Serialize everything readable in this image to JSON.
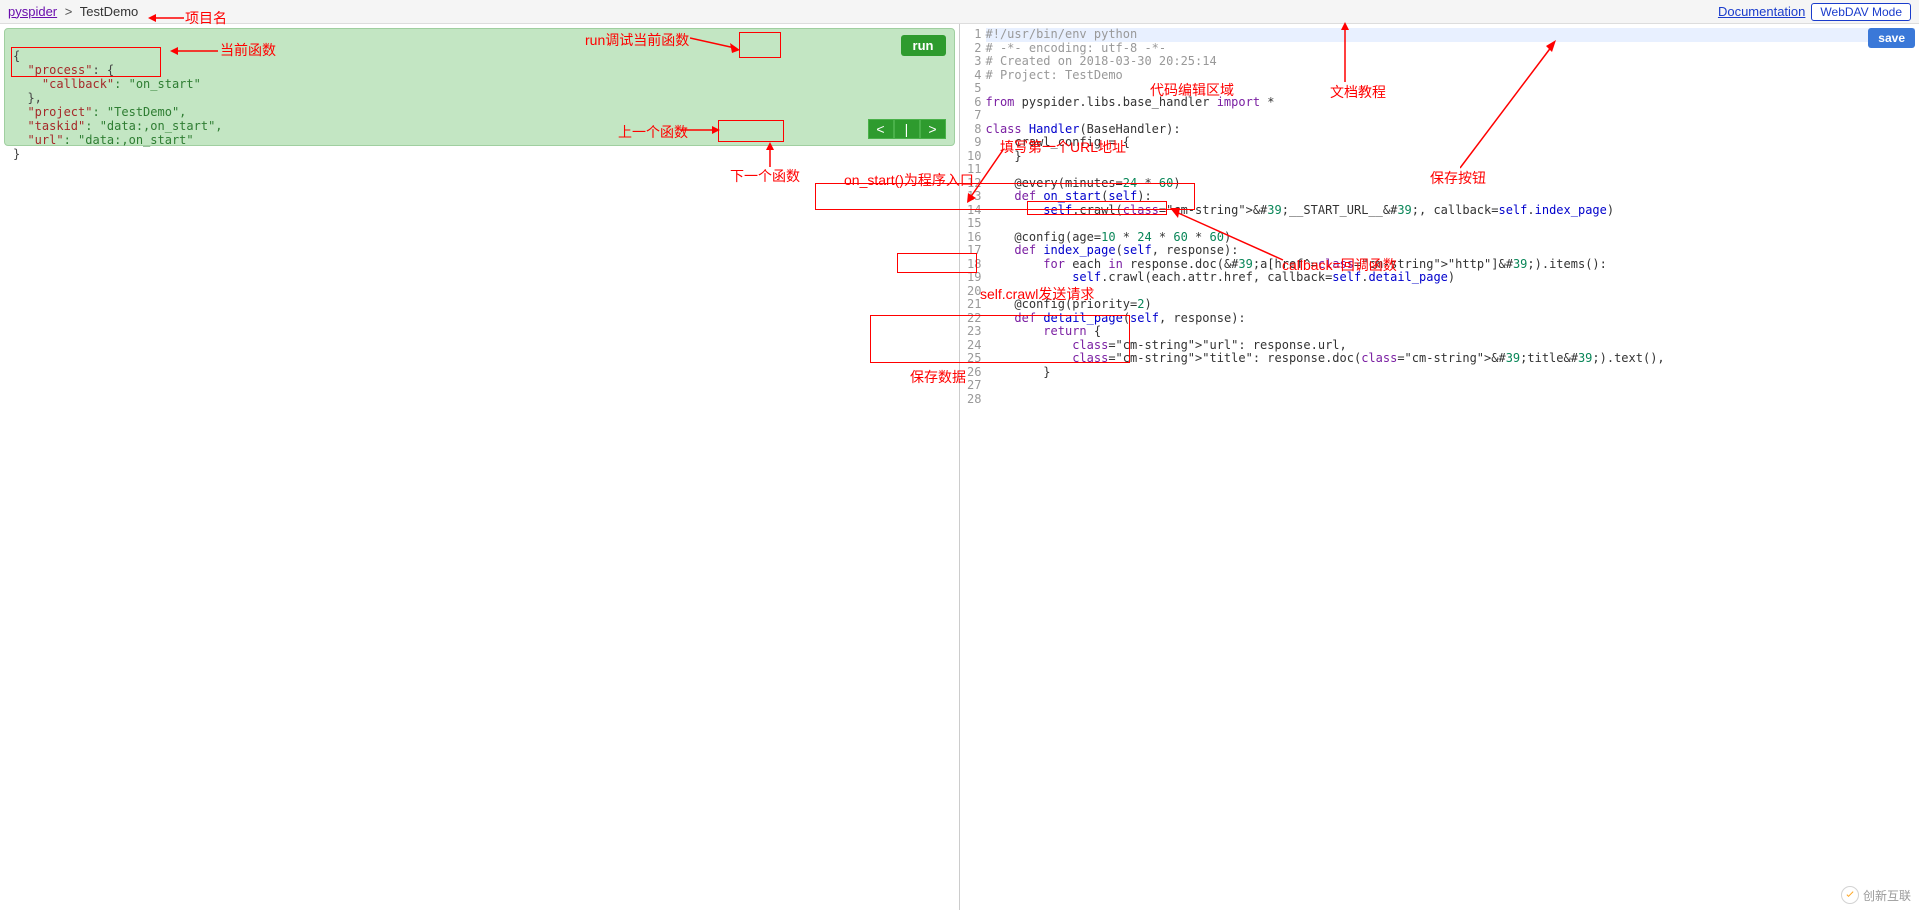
{
  "header": {
    "root_link": "pyspider",
    "sep": ">",
    "project_name": "TestDemo",
    "documentation": "Documentation",
    "webdav": "WebDAV Mode"
  },
  "task_json": {
    "brace_open": "{",
    "l1_key": "\"process\"",
    "l1_open": ": {",
    "l2_key": "\"callback\"",
    "l2_val": ": \"on_start\"",
    "l1_close": "},",
    "l3_key": "\"project\"",
    "l3_val": ": \"TestDemo\",",
    "l4_key": "\"taskid\"",
    "l4_val": ": \"data:,on_start\",",
    "l5_key": "\"url\"",
    "l5_val": ": \"data:,on_start\"",
    "brace_close": "}"
  },
  "buttons": {
    "run": "run",
    "prev": "<",
    "pipe": "|",
    "next": ">",
    "save": "save"
  },
  "code": {
    "line_count": 28,
    "lines": [
      "#!/usr/bin/env python",
      "# -*- encoding: utf-8 -*-",
      "# Created on 2018-03-30 20:25:14",
      "# Project: TestDemo",
      "",
      "from pyspider.libs.base_handler import *",
      "",
      "class Handler(BaseHandler):",
      "    crawl_config = {",
      "    }",
      "",
      "    @every(minutes=24 * 60)",
      "    def on_start(self):",
      "        self.crawl('__START_URL__', callback=self.index_page)",
      "",
      "    @config(age=10 * 24 * 60 * 60)",
      "    def index_page(self, response):",
      "        for each in response.doc('a[href^=\"http\"]').items():",
      "            self.crawl(each.attr.href, callback=self.detail_page)",
      "",
      "    @config(priority=2)",
      "    def detail_page(self, response):",
      "        return {",
      "            \"url\": response.url,",
      "            \"title\": response.doc('title').text(),",
      "        }",
      "",
      ""
    ]
  },
  "annotations": {
    "project_name": "项目名",
    "current_func": "当前函数",
    "run_debug": "run调试当前函数",
    "prev_func": "上一个函数",
    "next_func": "下一个函数",
    "code_area": "代码编辑区域",
    "doc_tutorial": "文档教程",
    "save_button": "保存按钮",
    "first_url": "填写第一个URL地址",
    "entry_point": "on_start()为程序入口",
    "callback_func": "callback=回调函数",
    "crawl_send": "self.crawl发送请求",
    "save_data": "保存数据"
  },
  "watermark": "创新互联"
}
